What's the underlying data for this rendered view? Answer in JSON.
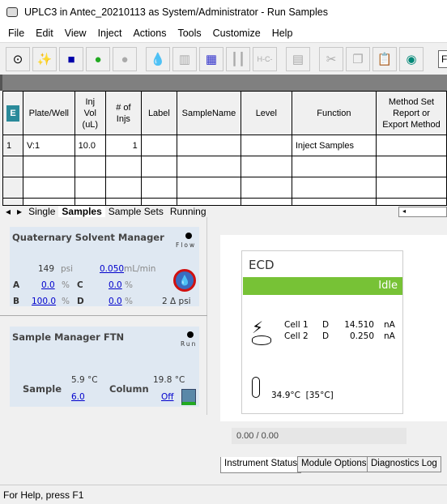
{
  "window": {
    "title": "UPLC3 in Antec_20210113 as System/Administrator - Run Samples"
  },
  "menu": [
    "File",
    "Edit",
    "View",
    "Inject",
    "Actions",
    "Tools",
    "Customize",
    "Help"
  ],
  "toolbar": {
    "partial_field": "F"
  },
  "table": {
    "headers": [
      "Plate/Well",
      "Inj Vol (uL)",
      "# of Injs",
      "Label",
      "SampleName",
      "Level",
      "Function",
      "Method Set Report or Export Method"
    ],
    "rows": [
      {
        "num": "1",
        "cells": [
          "V:1",
          "10.0",
          "1",
          "",
          "",
          "",
          "Inject Samples",
          ""
        ]
      }
    ]
  },
  "tabs": {
    "items": [
      "Single",
      "Samples",
      "Sample Sets",
      "Running"
    ],
    "active": "Samples"
  },
  "qsm": {
    "title": "Quaternary Solvent Manager",
    "lamp_label": "Flow",
    "pressure": "149",
    "pressure_unit": "psi",
    "flow": "0.050",
    "flow_unit": "mL/min",
    "A": "0.0",
    "B": "100.0",
    "C": "0.0",
    "D": "0.0",
    "labels": {
      "A": "A",
      "B": "B",
      "C": "C",
      "D": "D"
    },
    "pct": "%",
    "delta": "2 Δ psi"
  },
  "sm": {
    "title": "Sample Manager FTN",
    "lamp_label": "Run",
    "sample_label": "Sample",
    "sample_temp": "5.9 °C",
    "sample_set": "6.0",
    "column_label": "Column",
    "column_temp": "19.8 °C",
    "column_set": "Off"
  },
  "ecd": {
    "title": "ECD",
    "status": "Idle",
    "status_color": "#77c236",
    "cells": [
      {
        "name": "Cell 1",
        "mode": "D",
        "value": "14.510",
        "unit": "nA"
      },
      {
        "name": "Cell 2",
        "mode": "D",
        "value": "0.250",
        "unit": "nA"
      }
    ],
    "temp": "34.9°C  [35°C]"
  },
  "progress": "0.00 / 0.00",
  "bottom_tabs": [
    "Instrument Status",
    "Module Options",
    "Diagnostics Log"
  ],
  "status": "For Help, press F1"
}
